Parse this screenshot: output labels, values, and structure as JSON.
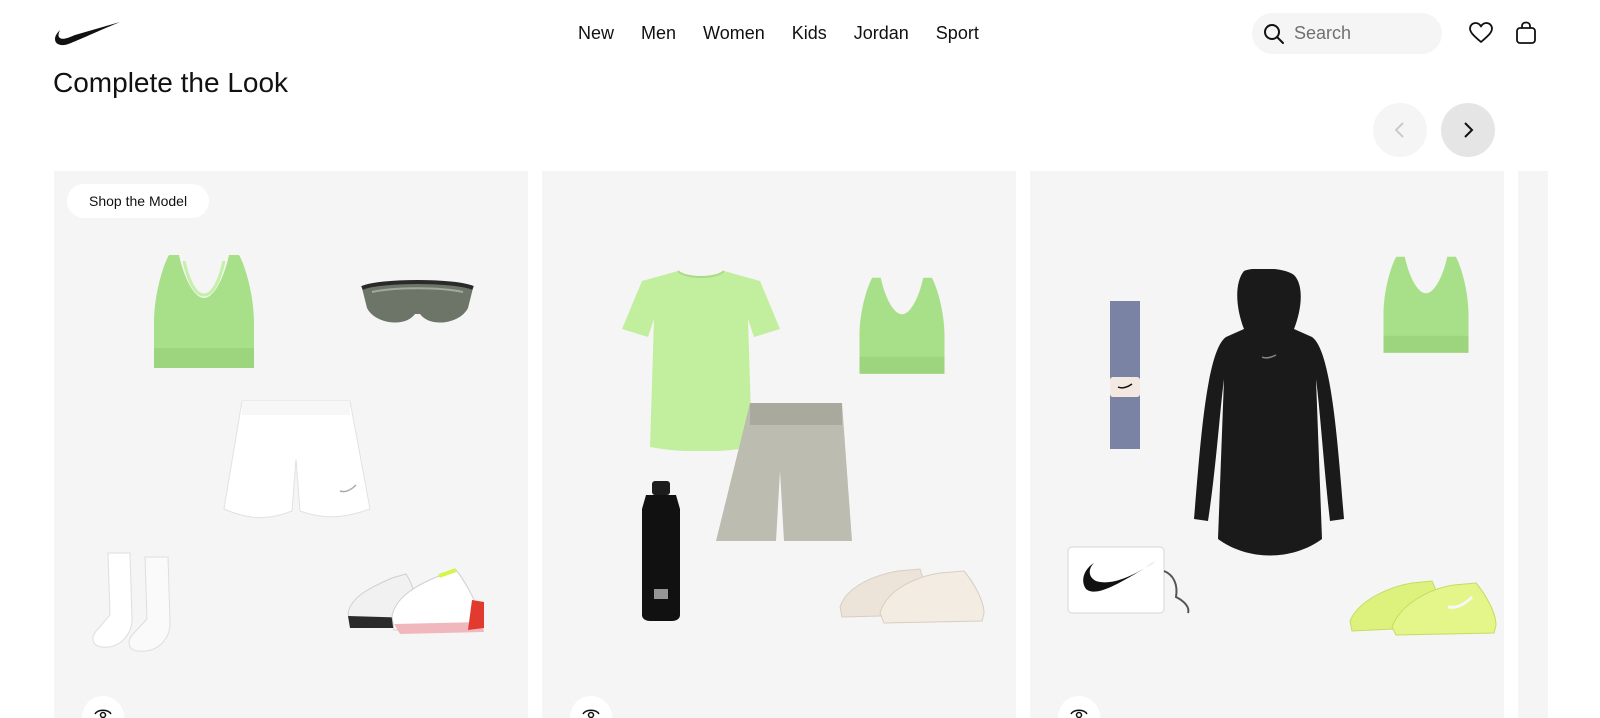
{
  "nav": {
    "items": [
      "New",
      "Men",
      "Women",
      "Kids",
      "Jordan",
      "Sport"
    ]
  },
  "search": {
    "placeholder": "Search"
  },
  "section": {
    "title": "Complete the Look"
  },
  "cards": [
    {
      "badge": "Shop the Model"
    }
  ],
  "colors": {
    "card_bg": "#f5f5f5",
    "volt_green": "#b8ec8e",
    "text": "#111111"
  }
}
